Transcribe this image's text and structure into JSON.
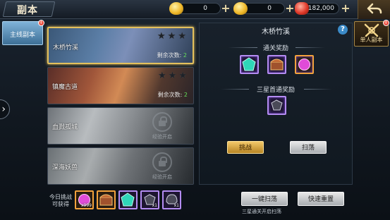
{
  "header": {
    "title": "副本",
    "resources": [
      {
        "icon": "gold-ingot-icon",
        "value": "0"
      },
      {
        "icon": "gold-ingot-icon",
        "value": "0"
      },
      {
        "icon": "coin-icon",
        "value": "182,000"
      }
    ]
  },
  "sidebar": {
    "tab_label": "主线副本",
    "tab_badge": "!"
  },
  "dungeons": [
    {
      "name": "木桥竹溪",
      "count_label": "剩余次数:",
      "count": "2",
      "locked": false,
      "selected": true
    },
    {
      "name": "镇魔古道",
      "count_label": "剩余次数:",
      "count": "2",
      "locked": false,
      "selected": false
    },
    {
      "name": "血戮孤城",
      "lock_text": "经验开启",
      "locked": true
    },
    {
      "name": "深海妖兽",
      "lock_text": "经验开启",
      "locked": true
    }
  ],
  "panel": {
    "title": "木桥竹溪",
    "help": "?",
    "clear_reward_title": "通关奖励",
    "first_reward_title": "三星首通奖励",
    "challenge_button": "挑战",
    "sweep_button": "扫荡"
  },
  "single_tab": {
    "label": "单人副本",
    "badge": "!"
  },
  "bottom": {
    "today_label_line1": "今日挑战",
    "today_label_line2": "可获得",
    "items": [
      {
        "qty": "x999",
        "color": "orange"
      },
      {
        "qty": "",
        "color": "orange"
      },
      {
        "qty": "",
        "color": "purple"
      },
      {
        "qty": "x1",
        "color": "purple"
      },
      {
        "qty": "x1",
        "color": "purple"
      }
    ],
    "one_key_sweep": "一键扫荡",
    "quick_reset": "快速重置",
    "sweep_hint": "三星通关开启扫荡"
  },
  "colors": {
    "accent_gold": "#e3c05d",
    "rare_purple": "#b48cf2",
    "epic_orange": "#f2a23c",
    "remaining_green": "#64e05a"
  }
}
